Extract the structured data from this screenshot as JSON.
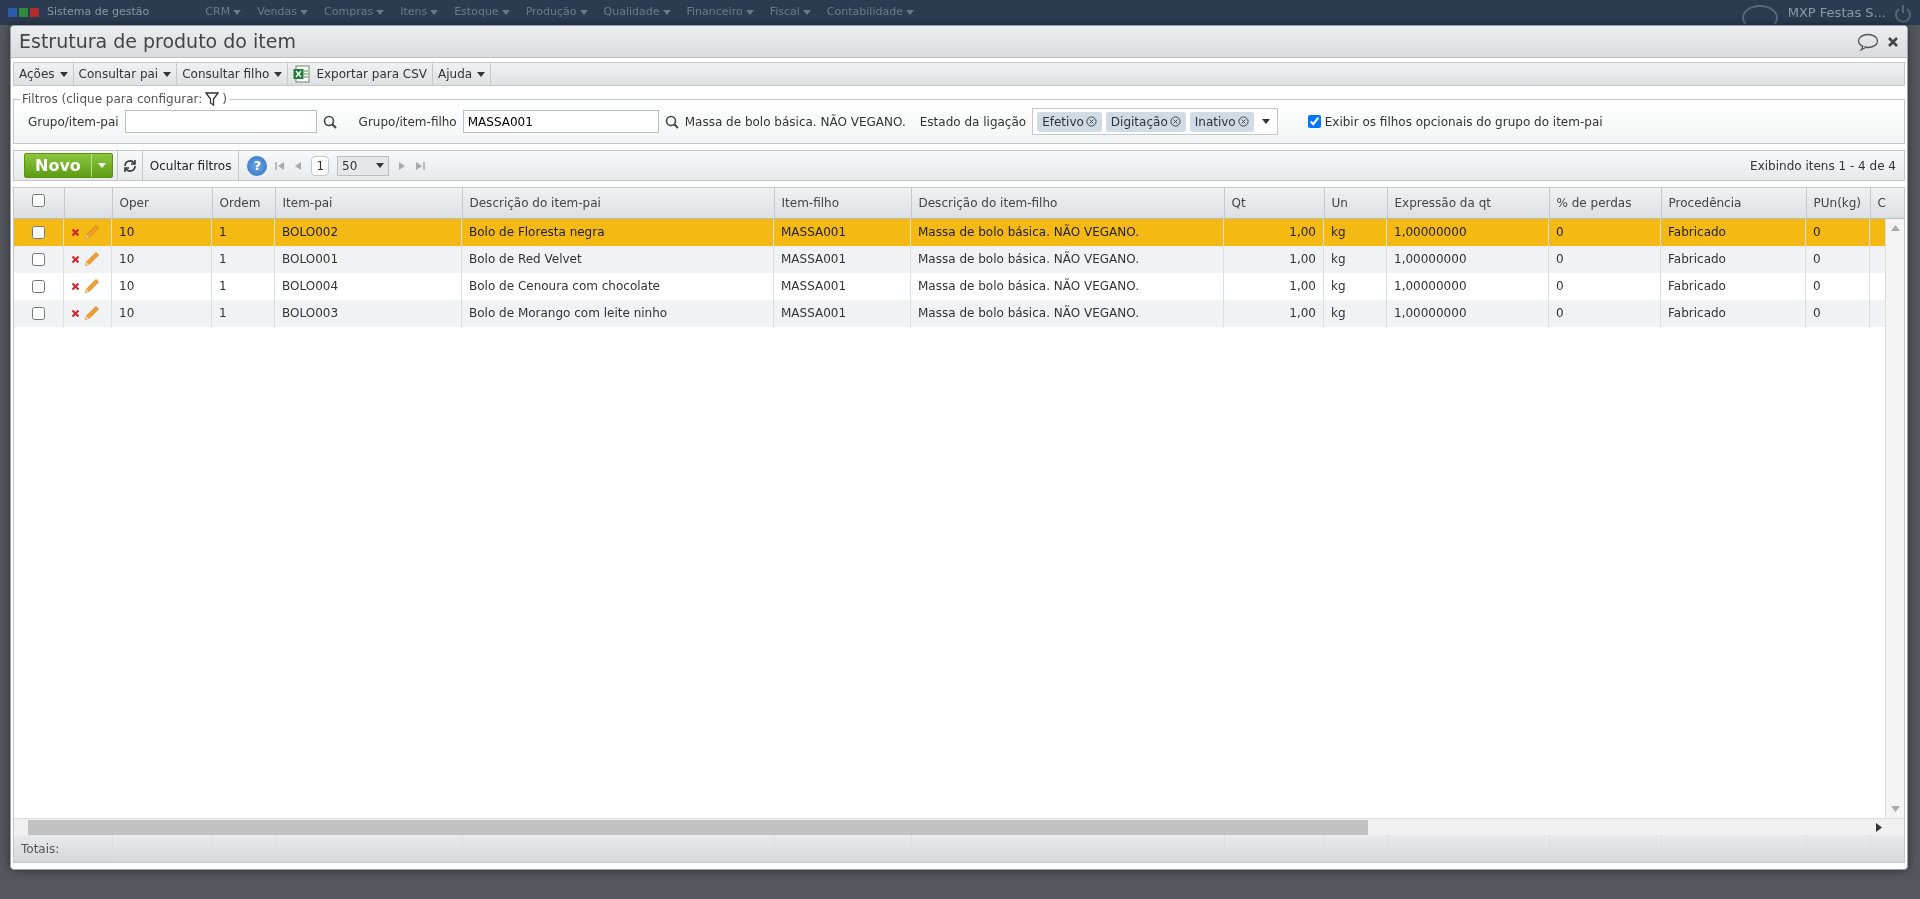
{
  "topbar": {
    "app_title": "Sistema de gestão",
    "menu": [
      "CRM",
      "Vendas",
      "Compras",
      "Itens",
      "Estoque",
      "Produção",
      "Qualidade",
      "Financeiro",
      "Fiscal",
      "Contabilidade"
    ],
    "company": "MXP Festas S..."
  },
  "window": {
    "title": "Estrutura de produto do item"
  },
  "toolbar": [
    {
      "label": "Ações",
      "kind": "menu"
    },
    {
      "label": "Consultar pai",
      "kind": "menu"
    },
    {
      "label": "Consultar filho",
      "kind": "menu"
    },
    {
      "label": "Exportar para CSV",
      "kind": "export"
    },
    {
      "label": "Ajuda",
      "kind": "menu"
    }
  ],
  "filters": {
    "legend_start": "Filtros (clique para configurar:",
    "legend_end": ")",
    "parent_label": "Grupo/item-pai",
    "child_label": "Grupo/item-filho",
    "child_value": "MASSA001",
    "child_description": "Massa de bolo básica. NÃO VEGANO.",
    "status_label": "Estado da ligação",
    "status_tags": [
      "Efetivo",
      "Digitação",
      "Inativo"
    ],
    "optional_children": {
      "label": "Exibir os filhos opcionais do grupo do item-pai",
      "checked": true
    }
  },
  "grid_toolbar": {
    "new_button": "Novo",
    "hide_filters": "Ocultar filtros",
    "help": "?",
    "page": "1",
    "page_size": "50",
    "summary": "Exibindo itens 1 - 4 de 4"
  },
  "table": {
    "all_checked": false,
    "columns": [
      {
        "label": "Oper",
        "kind": "text"
      },
      {
        "label": "Ordem",
        "kind": "text"
      },
      {
        "label": "Item-pai",
        "kind": "text"
      },
      {
        "label": "Descrição do item-pai",
        "kind": "text"
      },
      {
        "label": "Item-filho",
        "kind": "text"
      },
      {
        "label": "Descrição do item-filho",
        "kind": "text"
      },
      {
        "label": "Qt",
        "kind": "number"
      },
      {
        "label": "Un",
        "kind": "text"
      },
      {
        "label": "Expressão da qt",
        "kind": "text"
      },
      {
        "label": "% de perdas",
        "kind": "text"
      },
      {
        "label": "Procedência",
        "kind": "text"
      },
      {
        "label": "PUn(kg)",
        "kind": "text"
      },
      {
        "label": "C",
        "kind": "text"
      }
    ],
    "rows": [
      {
        "selected": true,
        "checked": false,
        "cells": [
          "10",
          "1",
          "BOLO002",
          "Bolo de Floresta negra",
          "MASSA001",
          "Massa de bolo básica. NÃO VEGANO.",
          "1,00",
          "kg",
          "1,00000000",
          "0",
          "Fabricado",
          "0"
        ]
      },
      {
        "selected": false,
        "checked": false,
        "cells": [
          "10",
          "1",
          "BOLO001",
          "Bolo de Red Velvet",
          "MASSA001",
          "Massa de bolo básica. NÃO VEGANO.",
          "1,00",
          "kg",
          "1,00000000",
          "0",
          "Fabricado",
          "0"
        ]
      },
      {
        "selected": false,
        "checked": false,
        "cells": [
          "10",
          "1",
          "BOLO004",
          "Bolo de Cenoura com chocolate",
          "MASSA001",
          "Massa de bolo básica. NÃO VEGANO.",
          "1,00",
          "kg",
          "1,00000000",
          "0",
          "Fabricado",
          "0"
        ]
      },
      {
        "selected": false,
        "checked": false,
        "cells": [
          "10",
          "1",
          "BOLO003",
          "Bolo de Morango com leite ninho",
          "MASSA001",
          "Massa de bolo básica. NÃO VEGANO.",
          "1,00",
          "kg",
          "1,00000000",
          "0",
          "Fabricado",
          "0"
        ]
      }
    ],
    "totals_label": "Totais:"
  }
}
